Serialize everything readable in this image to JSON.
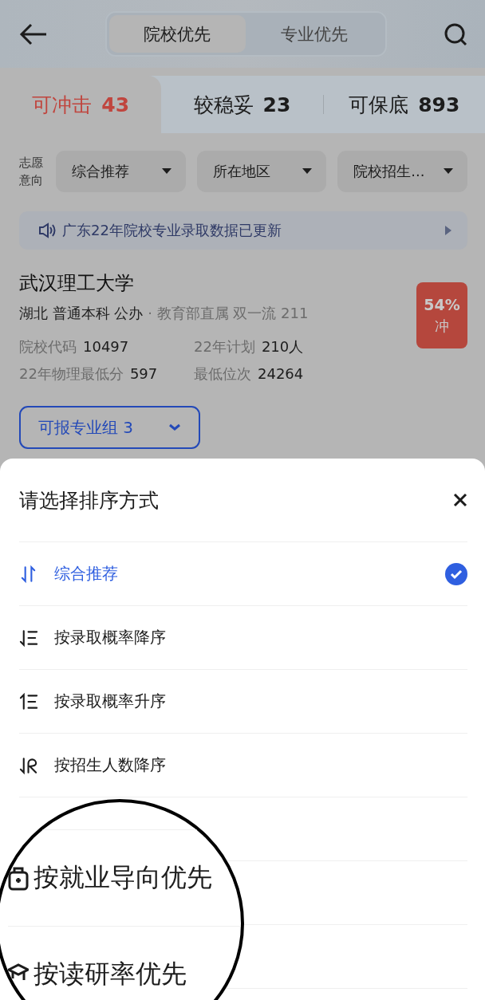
{
  "header": {
    "tabs": [
      {
        "label": "院校优先",
        "selected": true
      },
      {
        "label": "专业优先",
        "selected": false
      }
    ]
  },
  "risk_tabs": [
    {
      "label": "可冲击",
      "count": "43",
      "selected": true
    },
    {
      "label": "较稳妥",
      "count": "23",
      "selected": false
    },
    {
      "label": "可保底",
      "count": "893",
      "selected": false
    }
  ],
  "filters": {
    "label": "志愿意向",
    "items": [
      "综合推荐",
      "所在地区",
      "院校招生..."
    ]
  },
  "notice": "广东22年院校专业录取数据已更新",
  "school": {
    "name": "武汉理工大学",
    "tags": "湖北 普通本科 公办",
    "tags_secondary": "· 教育部直属 双一流 211",
    "stats": [
      {
        "label": "院校代码",
        "value": "10497"
      },
      {
        "label": "22年计划",
        "value": "210人"
      },
      {
        "label": "22年物理最低分",
        "value": "597"
      },
      {
        "label": "最低位次",
        "value": "24264"
      }
    ],
    "badge": {
      "percent": "54%",
      "label": "冲"
    },
    "groups_button": "可报专业组 3"
  },
  "sheet": {
    "title": "请选择排序方式",
    "options": [
      {
        "label": "综合推荐",
        "kind": "recommend",
        "selected": true
      },
      {
        "label": "按录取概率降序",
        "kind": "desc",
        "selected": false
      },
      {
        "label": "按录取概率升序",
        "kind": "asc",
        "selected": false
      },
      {
        "label": "按招生人数降序",
        "kind": "people",
        "selected": false
      }
    ]
  },
  "magnifier": {
    "items": [
      {
        "label": "按就业导向优先",
        "kind": "job"
      },
      {
        "label": "按读研率优先",
        "kind": "study"
      }
    ]
  }
}
